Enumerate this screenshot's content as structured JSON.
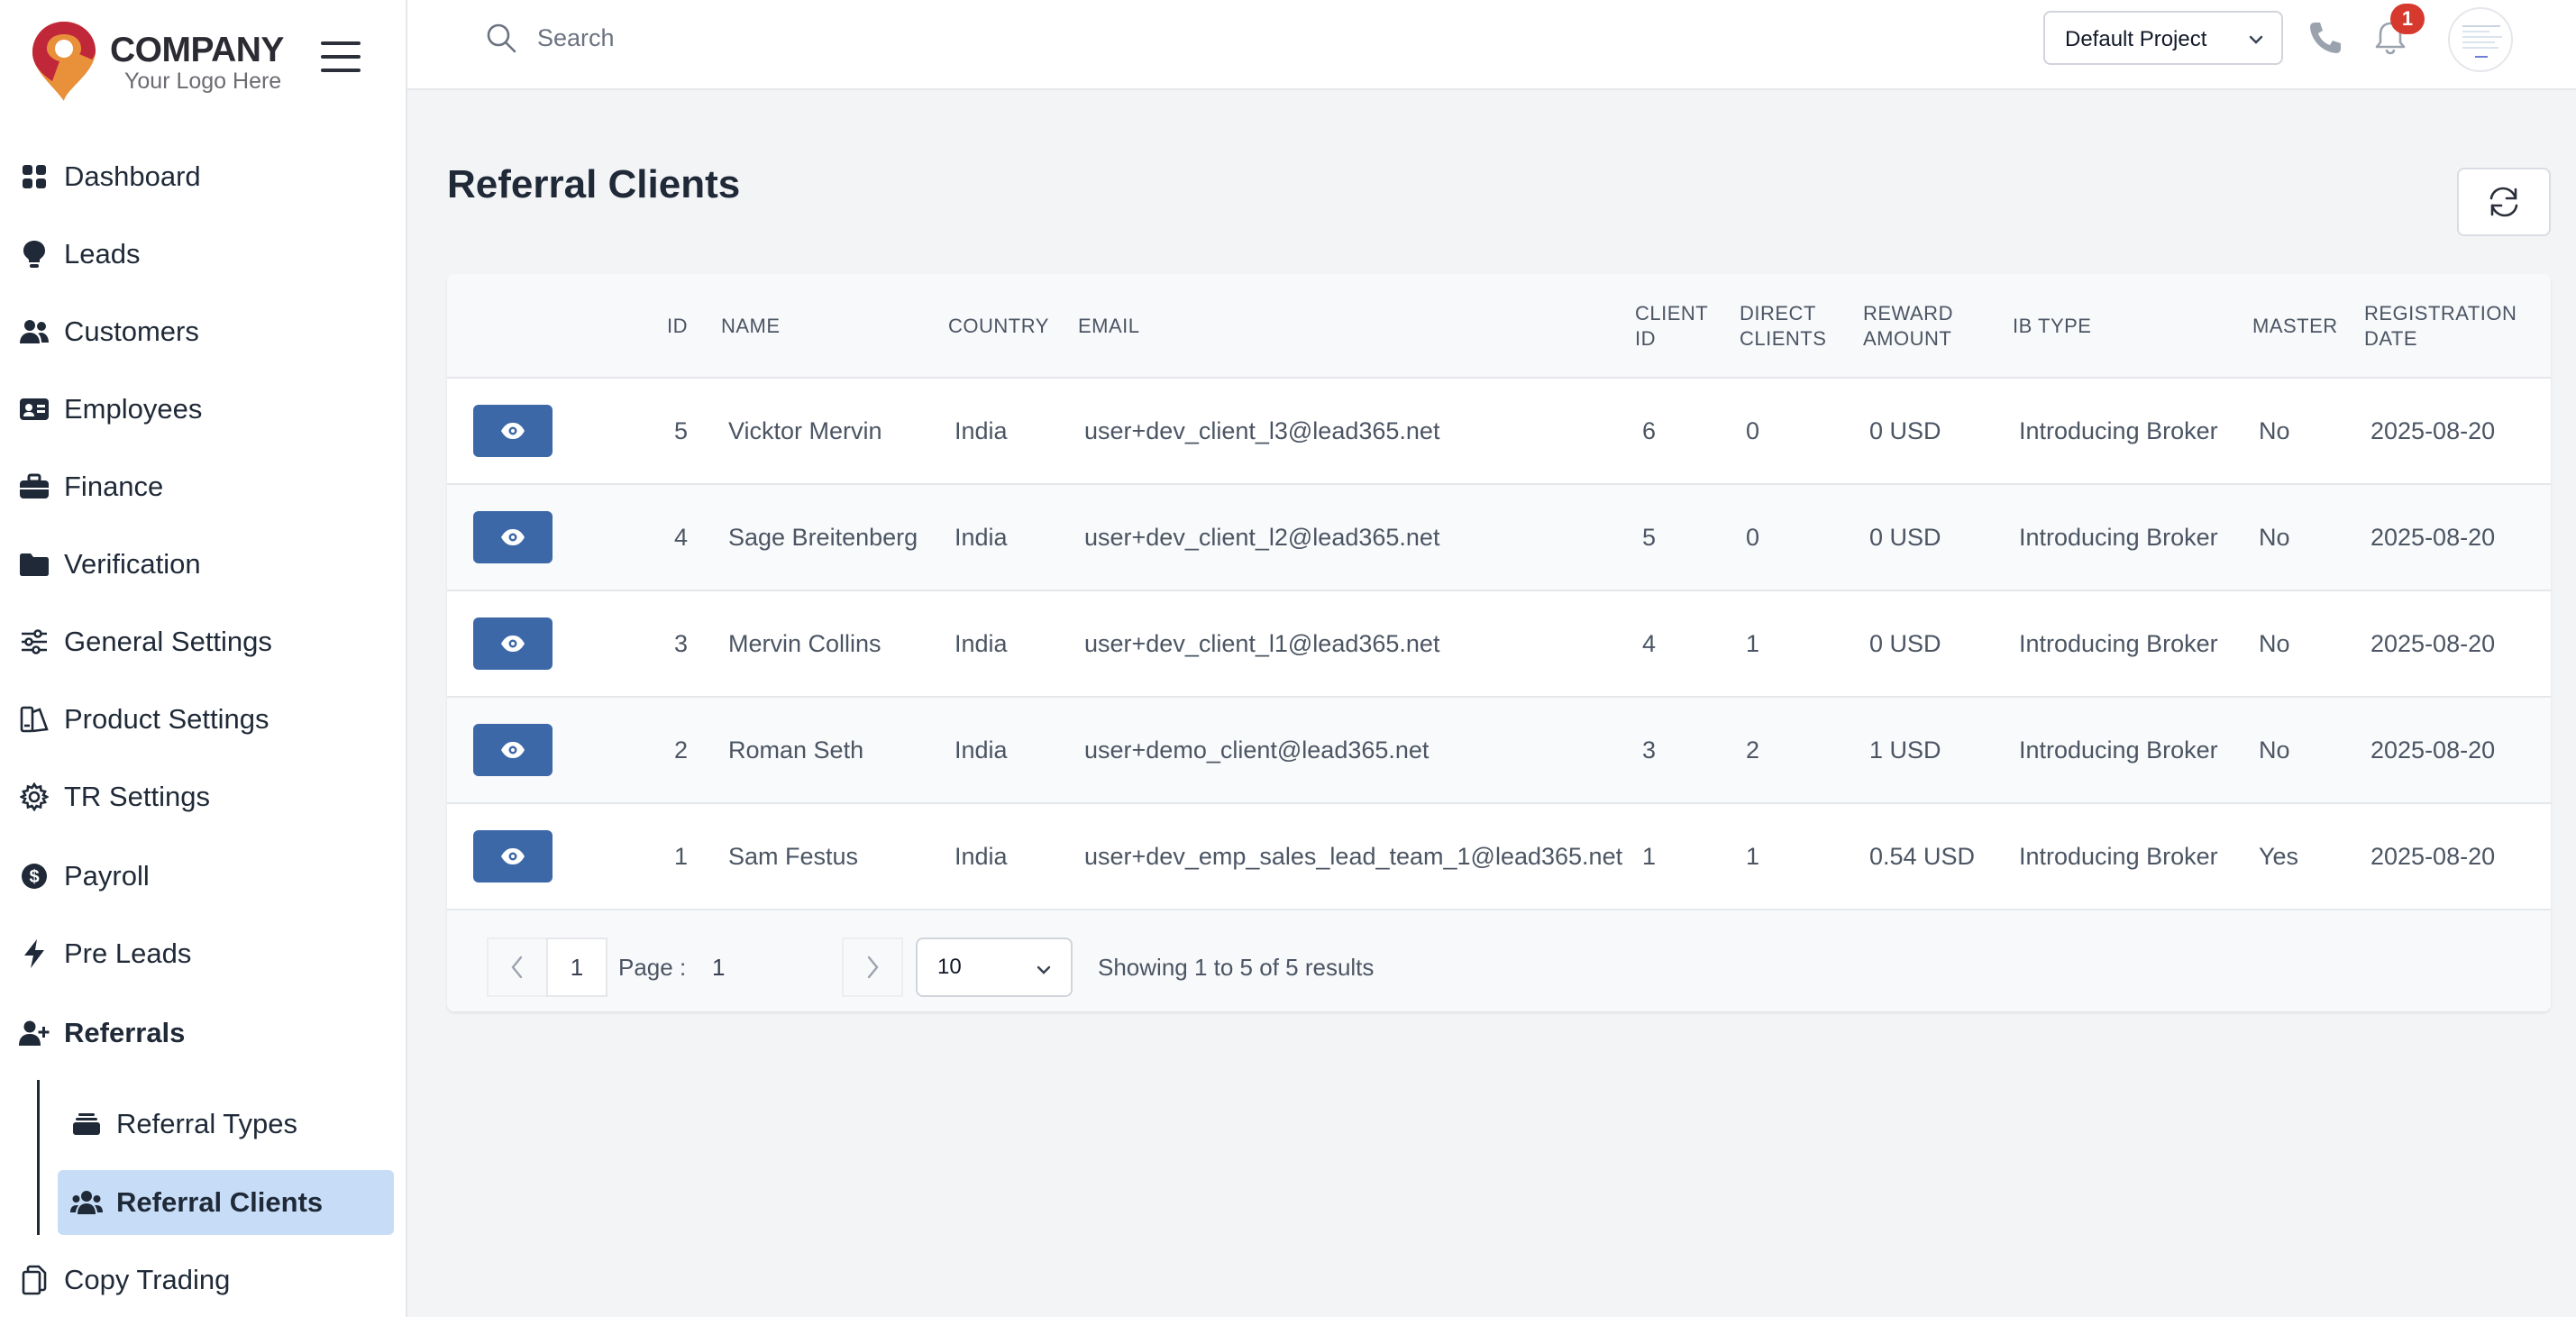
{
  "brand": {
    "name": "COMPANY",
    "tagline": "Your Logo Here"
  },
  "sidebar": {
    "items": [
      {
        "label": "Dashboard",
        "icon": "grid-icon"
      },
      {
        "label": "Leads",
        "icon": "lightbulb-icon"
      },
      {
        "label": "Customers",
        "icon": "users-icon"
      },
      {
        "label": "Employees",
        "icon": "id-card-icon"
      },
      {
        "label": "Finance",
        "icon": "briefcase-icon"
      },
      {
        "label": "Verification",
        "icon": "folder-icon"
      },
      {
        "label": "General Settings",
        "icon": "sliders-icon"
      },
      {
        "label": "Product Settings",
        "icon": "product-icon"
      },
      {
        "label": "TR Settings",
        "icon": "gear-icon"
      },
      {
        "label": "Payroll",
        "icon": "dollar-circle-icon"
      },
      {
        "label": "Pre Leads",
        "icon": "bolt-icon"
      },
      {
        "label": "Referrals",
        "icon": "user-plus-icon"
      }
    ],
    "sub_items": [
      {
        "label": "Referral Types",
        "icon": "layers-icon"
      },
      {
        "label": "Referral Clients",
        "icon": "users-icon"
      }
    ],
    "last_item": {
      "label": "Copy Trading",
      "icon": "copy-icon"
    }
  },
  "topbar": {
    "search_placeholder": "Search",
    "project": "Default Project",
    "notification_count": "1"
  },
  "page": {
    "title": "Referral Clients"
  },
  "table": {
    "headers": {
      "id": "ID",
      "name": "NAME",
      "country": "COUNTRY",
      "email": "EMAIL",
      "client_id": "CLIENT ID",
      "direct_clients": "DIRECT CLIENTS",
      "reward_amount": "REWARD AMOUNT",
      "ib_type": "IB TYPE",
      "master": "MASTER",
      "registration_date": "REGISTRATION DATE"
    },
    "rows": [
      {
        "id": "5",
        "name": "Vicktor Mervin",
        "country": "India",
        "email": "user+dev_client_l3@lead365.net",
        "client_id": "6",
        "direct_clients": "0",
        "reward_amount": "0 USD",
        "ib_type": "Introducing Broker",
        "master": "No",
        "registration_date": "2025-08-20"
      },
      {
        "id": "4",
        "name": "Sage Breitenberg",
        "country": "India",
        "email": "user+dev_client_l2@lead365.net",
        "client_id": "5",
        "direct_clients": "0",
        "reward_amount": "0 USD",
        "ib_type": "Introducing Broker",
        "master": "No",
        "registration_date": "2025-08-20"
      },
      {
        "id": "3",
        "name": "Mervin Collins",
        "country": "India",
        "email": "user+dev_client_l1@lead365.net",
        "client_id": "4",
        "direct_clients": "1",
        "reward_amount": "0 USD",
        "ib_type": "Introducing Broker",
        "master": "No",
        "registration_date": "2025-08-20"
      },
      {
        "id": "2",
        "name": "Roman Seth",
        "country": "India",
        "email": "user+demo_client@lead365.net",
        "client_id": "3",
        "direct_clients": "2",
        "reward_amount": "1 USD",
        "ib_type": "Introducing Broker",
        "master": "No",
        "registration_date": "2025-08-20"
      },
      {
        "id": "1",
        "name": "Sam Festus",
        "country": "India",
        "email": "user+dev_emp_sales_lead_team_1@lead365.net",
        "client_id": "1",
        "direct_clients": "1",
        "reward_amount": "0.54 USD",
        "ib_type": "Introducing Broker",
        "master": "Yes",
        "registration_date": "2025-08-20"
      }
    ]
  },
  "pagination": {
    "current_page": "1",
    "page_label": "Page :",
    "page_value": "1",
    "page_size": "10",
    "showing": "Showing 1 to 5 of 5 results"
  },
  "colors": {
    "accent": "#3d68a8",
    "active_bg": "#c7ddf7",
    "badge": "#d63a2f",
    "brand_red": "#c0283a",
    "brand_orange": "#e9903a"
  }
}
